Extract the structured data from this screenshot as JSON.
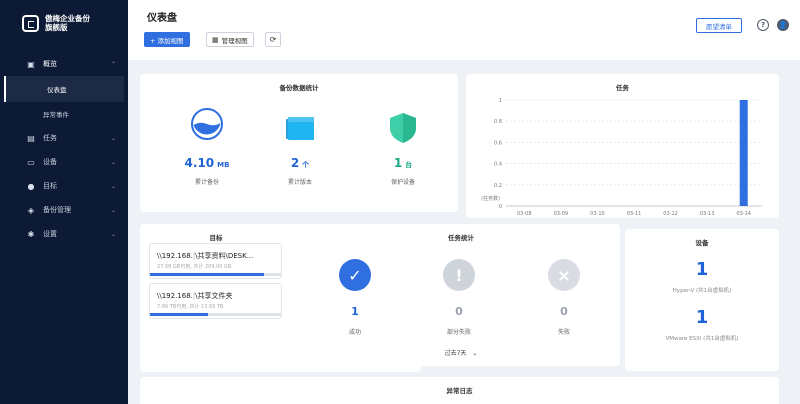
{
  "brand": {
    "line1": "傲梅企业备份",
    "line2": "旗舰版"
  },
  "sidebar": {
    "groups": [
      {
        "icon": "overview-icon",
        "label": "概览",
        "chev": "⌃"
      },
      {
        "icon": "task-icon",
        "label": "任务",
        "chev": "⌄"
      },
      {
        "icon": "device-icon",
        "label": "设备",
        "chev": "⌄"
      },
      {
        "icon": "target-icon",
        "label": "目标",
        "chev": "⌄"
      },
      {
        "icon": "backup-manage-icon",
        "label": "备份管理",
        "chev": "⌄"
      },
      {
        "icon": "settings-icon",
        "label": "设置",
        "chev": "⌄"
      }
    ],
    "sub": [
      {
        "label": "仪表盘"
      },
      {
        "label": "异常事件"
      }
    ]
  },
  "header": {
    "title": "仪表盘",
    "add_view": "+ 添加视图",
    "manage_view": "管理视图",
    "wishlist": "愿望清单",
    "help": "?"
  },
  "backup_stats": {
    "title": "备份数据统计",
    "items": [
      {
        "value": "4.10",
        "unit": "MB",
        "label": "累计备份"
      },
      {
        "value": "2",
        "unit": "个",
        "label": "累计版本"
      },
      {
        "value": "1",
        "unit": "台",
        "label": "保护设备"
      }
    ]
  },
  "tasks_card": {
    "title": "任务"
  },
  "chart_data": {
    "type": "bar",
    "title": "任务",
    "ylabel": "(任务数)",
    "categories": [
      "03-08",
      "03-09",
      "03-10",
      "03-11",
      "03-12",
      "03-13",
      "03-14"
    ],
    "values": [
      0,
      0,
      0,
      0,
      0,
      0,
      1
    ],
    "yticks": [
      "0",
      "0.2",
      "0.4",
      "0.6",
      "0.8",
      "1"
    ],
    "ylim": [
      0,
      1
    ],
    "grid": true,
    "color": "#2f6fe0"
  },
  "targets": {
    "title": "目标",
    "items": [
      {
        "path": "\\\\192.168.",
        "masked": "      ",
        "path2": "\\共享资料\\DESK...",
        "sub": "27.68 GB可用, 共计 209.00 GB",
        "usage": 0.87
      },
      {
        "path": "\\\\192.168.",
        "masked": "      ",
        "path2": "\\共享文件夹",
        "sub": "7.86 TB可用, 共计 13.93 TB",
        "usage": 0.44
      }
    ]
  },
  "task_stats": {
    "title": "任务统计",
    "items": [
      {
        "count": "1",
        "label": "成功",
        "color": "#2f6fe0",
        "symbol": "✓",
        "text_color": "#1f63d6"
      },
      {
        "count": "0",
        "label": "部分失败",
        "color": "#cfd3da",
        "symbol": "!",
        "text_color": "#9aa1ad"
      },
      {
        "count": "0",
        "label": "失败",
        "color": "#d9dde3",
        "symbol": "×",
        "text_color": "#9aa1ad"
      }
    ],
    "period": "过去7天"
  },
  "devices": {
    "title": "设备",
    "items": [
      {
        "count": "1",
        "label": "Hyper-V (共1台虚拟机)"
      },
      {
        "count": "1",
        "label": "VMware ESXi (共1台虚拟机)"
      }
    ]
  },
  "errors": {
    "title": "异常日志"
  }
}
